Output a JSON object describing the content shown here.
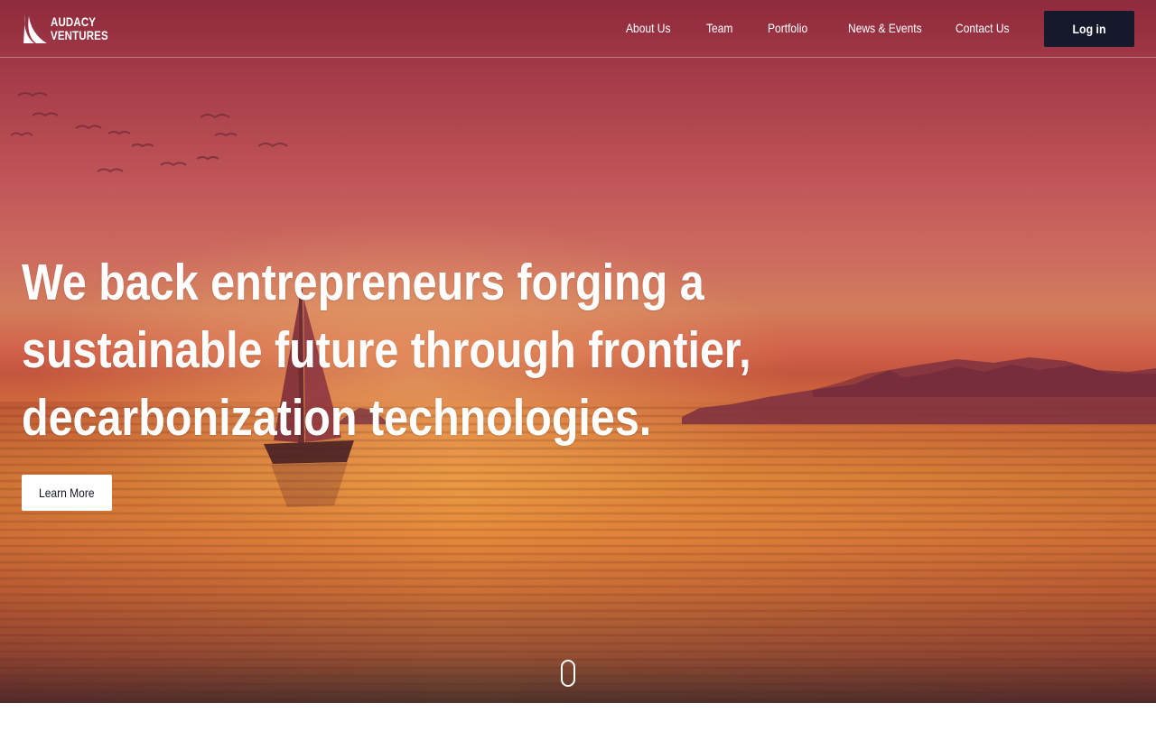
{
  "brand": {
    "name_line1": "AUDACY",
    "name_line2": "VENTURES",
    "icon": "sail-logo-icon"
  },
  "nav": {
    "items": [
      {
        "label": "About Us"
      },
      {
        "label": "Team"
      },
      {
        "label": "Portfolio"
      },
      {
        "label": "News & Events"
      },
      {
        "label": "Contact Us"
      }
    ],
    "login_label": "Log in"
  },
  "hero": {
    "headline": "We back entrepreneurs forging a sustainable future through frontier, decarbonization technologies.",
    "cta_label": "Learn More",
    "background": "sunset-sailboat-image",
    "scroll_icon": "scroll-mouse-icon"
  },
  "colors": {
    "login_button_bg": "#16182b",
    "text_on_hero": "#ffffff",
    "cta_bg": "#ffffff"
  }
}
